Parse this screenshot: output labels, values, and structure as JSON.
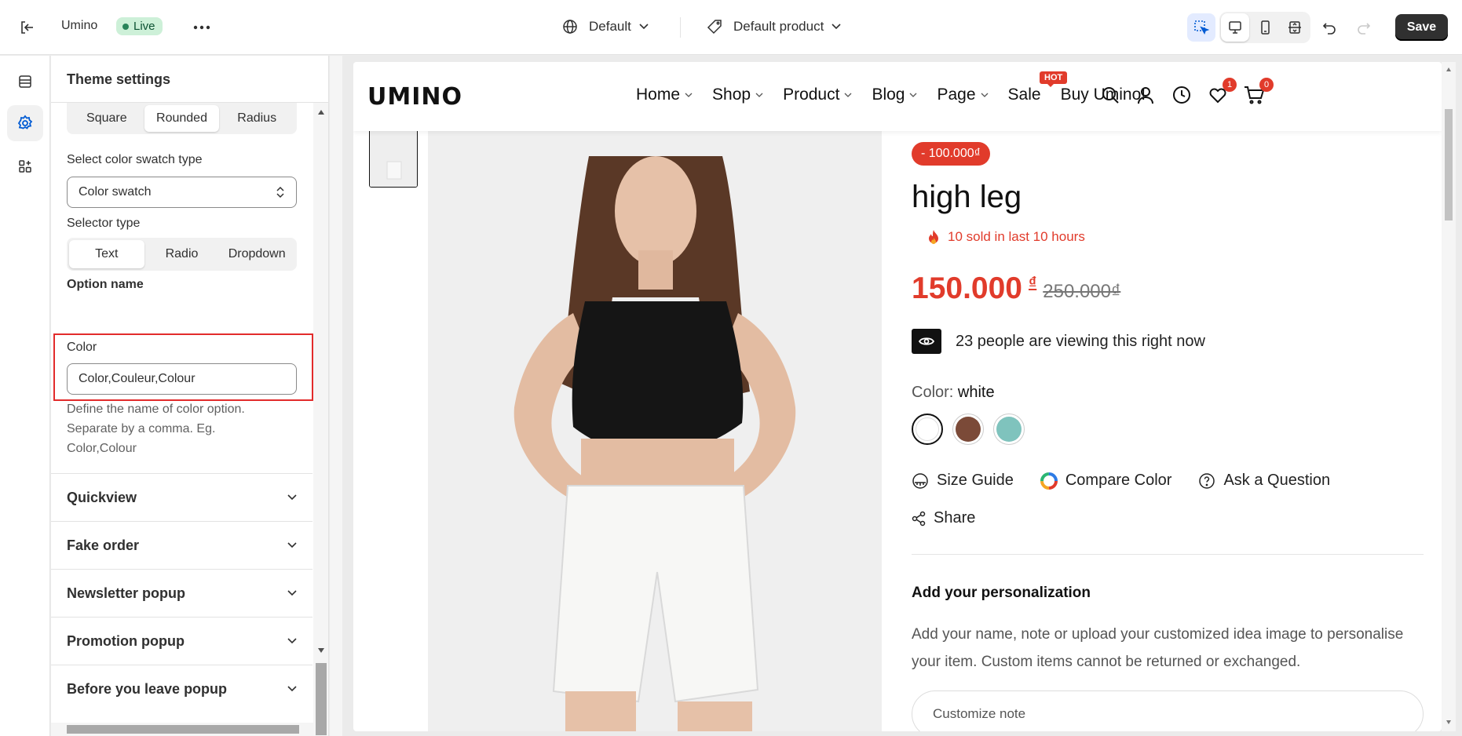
{
  "topbar": {
    "store_name": "Umino",
    "live_label": "Live",
    "theme_select": "Default",
    "template_select": "Default product",
    "save_label": "Save"
  },
  "panel": {
    "title": "Theme settings",
    "shape_options": [
      "Square",
      "Rounded",
      "Radius"
    ],
    "shape_selected": "Rounded",
    "swatch_type_label": "Select color swatch type",
    "swatch_type_value": "Color swatch",
    "selector_type_label": "Selector type",
    "selector_options": [
      "Text",
      "Radio",
      "Dropdown"
    ],
    "selector_selected": "Text",
    "option_name_heading": "Option name",
    "color_label": "Color",
    "color_value": "Color,Couleur,Colour",
    "color_help": "Define the name of color option. Separate by a comma. Eg. Color,Colour",
    "sections": [
      "Quickview",
      "Fake order",
      "Newsletter popup",
      "Promotion popup",
      "Before you leave popup"
    ]
  },
  "store": {
    "logo": "UMINO",
    "nav": [
      {
        "label": "Home",
        "dropdown": true
      },
      {
        "label": "Shop",
        "dropdown": true
      },
      {
        "label": "Product",
        "dropdown": true
      },
      {
        "label": "Blog",
        "dropdown": true
      },
      {
        "label": "Page",
        "dropdown": true
      },
      {
        "label": "Sale",
        "dropdown": false
      },
      {
        "label": "Buy Umino!",
        "dropdown": false
      }
    ],
    "hot_badge": "HOT",
    "wishlist_count": "1",
    "cart_count": "0"
  },
  "product": {
    "discount": "- 100.000₫",
    "title": "high leg",
    "sold_text": "10 sold in last 10 hours",
    "price": "150.000",
    "currency": "₫",
    "compare_price": "250.000₫",
    "viewing_text": "23 people are viewing this right now",
    "color_label": "Color:",
    "color_value": "white",
    "swatches": [
      "#ffffff",
      "#7b4a38",
      "#7fc3bd"
    ],
    "links": [
      "Size Guide",
      "Compare Color",
      "Ask a Question"
    ],
    "share_label": "Share",
    "personalization_title": "Add your personalization",
    "personalization_text": "Add your name, note or upload your customized idea image to personalise your item. Custom items cannot be returned or exchanged.",
    "customize_placeholder": "Customize note"
  },
  "colors": {
    "accent_red": "#e13b2b",
    "live_bg": "#cdf0d8",
    "highlight": "#e22b2b"
  }
}
